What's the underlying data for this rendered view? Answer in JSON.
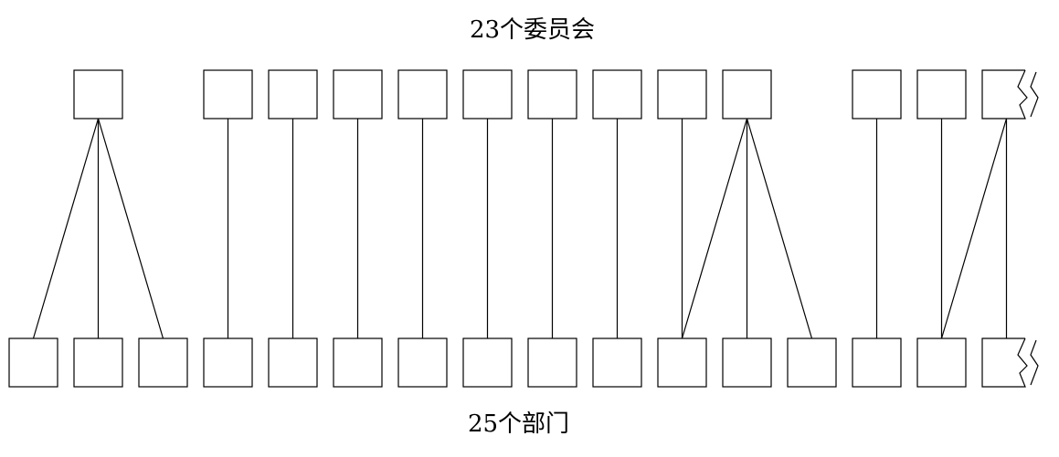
{
  "top_label": "23个委员会",
  "bottom_label": "25个部门",
  "colors": {
    "stroke": "#000000",
    "box_fill": "#ffffff",
    "background": "#ffffff"
  },
  "committees_count": 23,
  "departments_count": 25
}
